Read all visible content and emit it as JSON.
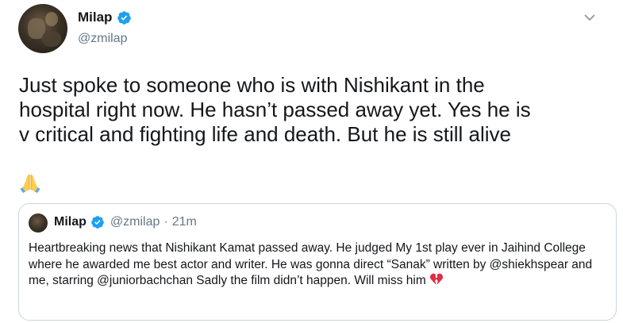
{
  "tweet": {
    "display_name": "Milap",
    "handle": "@zmilap",
    "verified_icon": "verified-badge-icon",
    "text": "Just spoke to someone who is with Nishikant in the\nhospital right now. He hasn’t passed away yet. Yes he is\nv critical and fighting life and death. But he is still alive",
    "emoji": "folded-hands-emoji"
  },
  "quote": {
    "display_name": "Milap",
    "handle": "@zmilap",
    "separator": "·",
    "time": "21m",
    "text": "Heartbreaking news that Nishikant Kamat passed away. He judged My 1st play ever in Jaihind College where he awarded me best actor and writer. He was gonna direct “Sanak” written by @shiekhspear and me, starring @juniorbachchan Sadly the film didn’t happen. Will miss him",
    "emoji": "broken-heart-emoji"
  },
  "colors": {
    "text": "#14171a",
    "secondary": "#657786",
    "verified": "#1da1f2",
    "border": "#ccd6dd"
  }
}
